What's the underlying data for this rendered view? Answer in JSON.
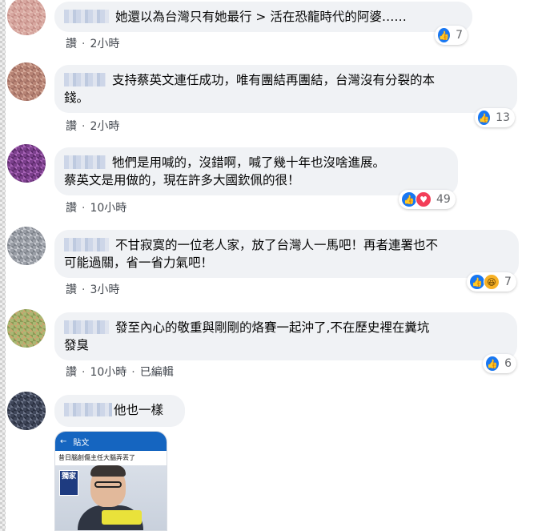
{
  "colors": {
    "bubble_bg": "#f0f2f5",
    "meta_text": "#444950",
    "like_blue": "#1877f2",
    "love_red": "#f33e58",
    "haha_yellow": "#f7b125"
  },
  "comments": [
    {
      "text_lines": [
        "她還以為台灣只有她最行 > 活在恐龍時代的阿婆……"
      ],
      "action": "讚",
      "time": "2小時",
      "edited": "",
      "reactions": [
        "like-icon"
      ],
      "reaction_count": "7"
    },
    {
      "text_lines": [
        "支持蔡英文連任成功，唯有團結再團結，台灣沒有分裂的本",
        "錢。"
      ],
      "action": "讚",
      "time": "2小時",
      "edited": "",
      "reactions": [
        "like-icon"
      ],
      "reaction_count": "13"
    },
    {
      "text_lines": [
        "牠們是用喊的，沒錯啊，喊了幾十年也沒啥進展。",
        "蔡英文是用做的，現在許多大國欽佩的很！"
      ],
      "action": "讚",
      "time": "10小時",
      "edited": "",
      "reactions": [
        "like-icon",
        "love-icon"
      ],
      "reaction_count": "49"
    },
    {
      "text_lines": [
        "不甘寂寞的一位老人家，放了台灣人一馬吧！再者連署也不",
        "可能過關，省一省力氣吧！"
      ],
      "action": "讚",
      "time": "3小時",
      "edited": "",
      "reactions": [
        "like-icon",
        "haha-icon"
      ],
      "reaction_count": "7"
    },
    {
      "text_lines": [
        "發至內心的敬重與剛剛的烙賽一起沖了,不在歷史裡在糞坑",
        "發臭"
      ],
      "action": "讚",
      "time": "10小時",
      "edited": "已編輯",
      "reactions": [
        "like-icon"
      ],
      "reaction_count": "6"
    },
    {
      "text_lines": [
        "他也一樣"
      ],
      "action": "",
      "time": "",
      "edited": "",
      "reactions": [],
      "reaction_count": ""
    }
  ],
  "attachment": {
    "bar_label": "貼文",
    "headline": "昔日腦創傷主任大腦弄丟了",
    "stamp": "獨家"
  },
  "separator": "·"
}
